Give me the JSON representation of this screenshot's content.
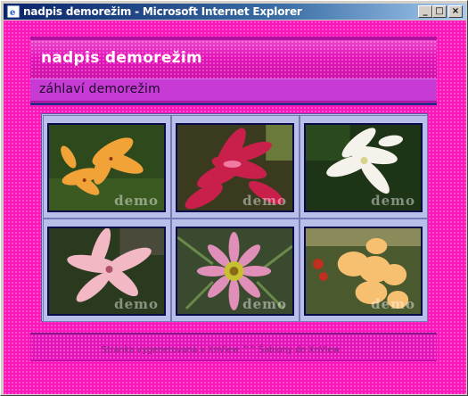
{
  "window": {
    "title": "nadpis demorežim - Microsoft Internet Explorer",
    "buttons": {
      "minimize": "_",
      "maximize": "□",
      "close": "×"
    }
  },
  "page": {
    "site_title": "nadpis demorežim",
    "subtitle": "záhlaví demorežim",
    "watermark": "demo",
    "footer": {
      "generated_text": "Stránka vygenerovaná v",
      "generator_link": "XnView",
      "separator": "^^",
      "templates_link": "Šablony do XnView"
    }
  },
  "gallery": {
    "thumbnails": [
      {
        "subject": "orange-lily"
      },
      {
        "subject": "red-pink-lily"
      },
      {
        "subject": "white-lily"
      },
      {
        "subject": "pink-lily"
      },
      {
        "subject": "pink-gazania"
      },
      {
        "subject": "peach-gladiolus"
      }
    ]
  },
  "colors": {
    "background": "#ff16ba",
    "titlebar": "#0a246a",
    "gallery_panel": "#b8bfe8",
    "divider": "#2a2a8a"
  }
}
